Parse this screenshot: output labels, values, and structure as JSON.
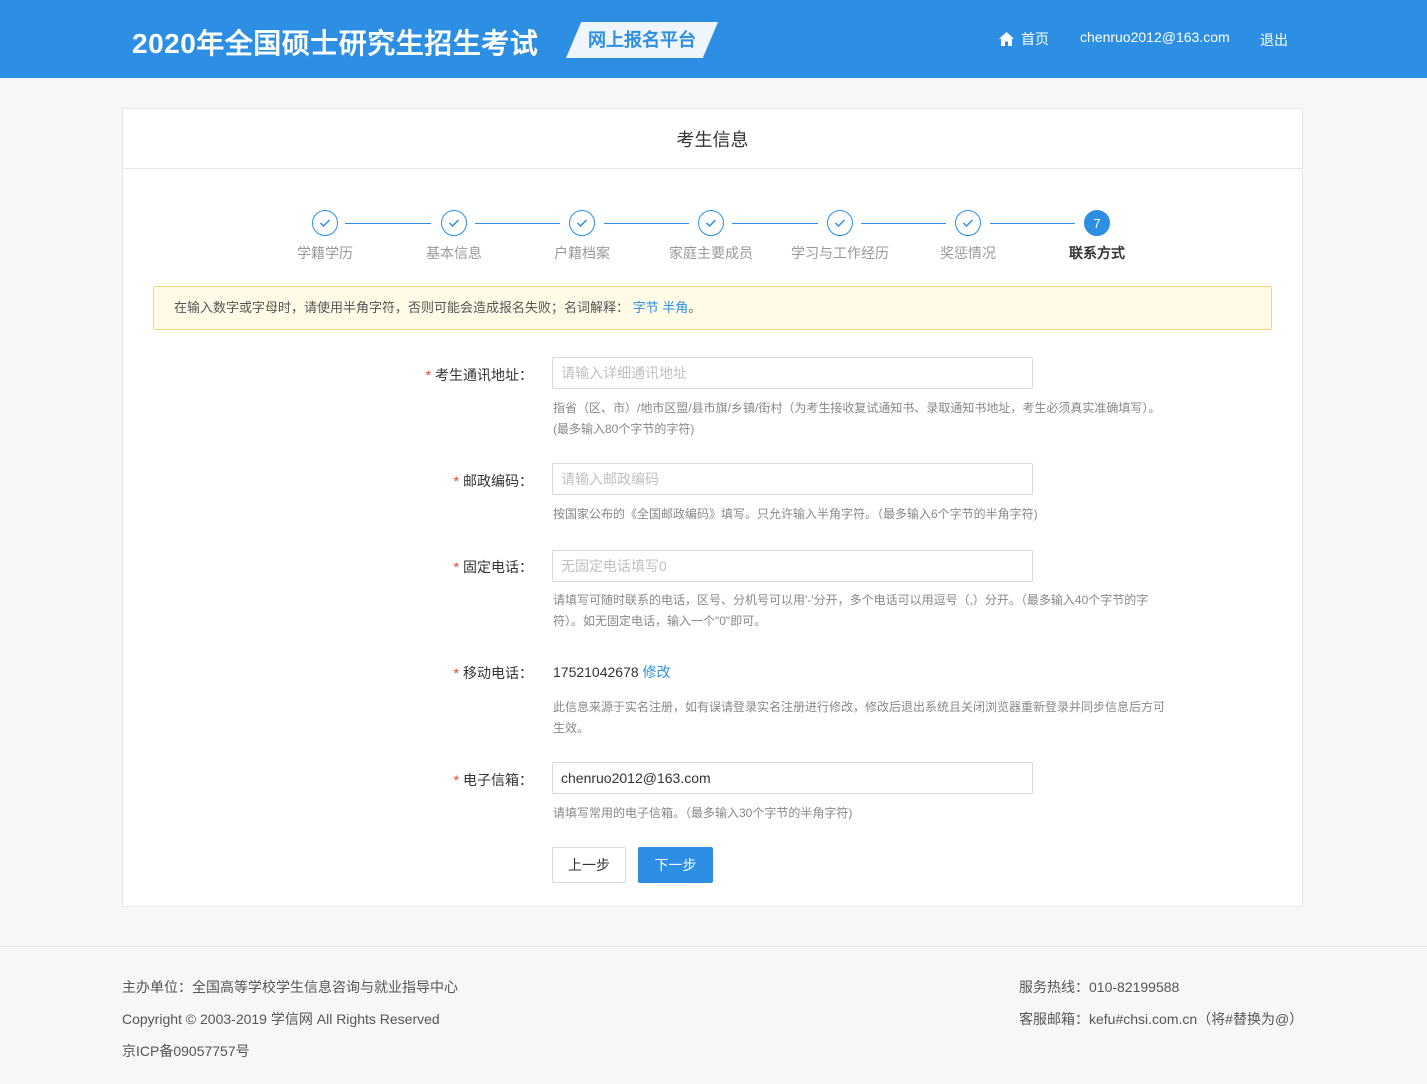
{
  "header": {
    "site_title": "2020年全国硕士研究生招生考试",
    "platform_badge": "网上报名平台",
    "home_label": "首页",
    "user_email": "chenruo2012@163.com",
    "logout_label": "退出"
  },
  "card": {
    "title": "考生信息"
  },
  "steps": [
    {
      "label": "学籍学历",
      "status": "done"
    },
    {
      "label": "基本信息",
      "status": "done"
    },
    {
      "label": "户籍档案",
      "status": "done"
    },
    {
      "label": "家庭主要成员",
      "status": "done"
    },
    {
      "label": "学习与工作经历",
      "status": "done"
    },
    {
      "label": "奖惩情况",
      "status": "done"
    },
    {
      "label": "联系方式",
      "status": "active",
      "number": "7"
    }
  ],
  "notice": {
    "text": "在输入数字或字母时，请使用半角字符，否则可能会造成报名失败；名词解释：",
    "link_byte": "字节",
    "link_halfwidth": "半角",
    "suffix": "。"
  },
  "form": {
    "address": {
      "label": "考生通讯地址：",
      "placeholder": "请输入详细通讯地址",
      "value": "",
      "help": "指省（区、市）/地市区盟/县市旗/乡镇/街村（为考生接收复试通知书、录取通知书地址，考生必须真实准确填写）。(最多输入80个字节的字符)"
    },
    "postcode": {
      "label": "邮政编码：",
      "placeholder": "请输入邮政编码",
      "value": "",
      "help": "按国家公布的《全国邮政编码》填写。只允许输入半角字符。（最多输入6个字节的半角字符)"
    },
    "landline": {
      "label": "固定电话：",
      "placeholder": "无固定电话填写0",
      "value": "",
      "help": "请填写可随时联系的电话，区号、分机号可以用'-'分开，多个电话可以用逗号（,）分开。（最多输入40个字节的字符）。如无固定电话，输入一个\"0\"即可。"
    },
    "mobile": {
      "label": "移动电话：",
      "value": "17521042678",
      "edit_label": "修改",
      "help": "此信息来源于实名注册，如有误请登录实名注册进行修改，修改后退出系统且关闭浏览器重新登录并同步信息后方可生效。"
    },
    "email": {
      "label": "电子信箱：",
      "placeholder": "",
      "value": "chenruo2012@163.com",
      "help": "请填写常用的电子信箱。（最多输入30个字节的半角字符)"
    },
    "required_mark": "*"
  },
  "buttons": {
    "prev": "上一步",
    "next": "下一步"
  },
  "footer": {
    "sponsor": "主办单位：全国高等学校学生信息咨询与就业指导中心",
    "copyright": "Copyright © 2003-2019 学信网 All Rights Reserved",
    "icp": "京ICP备09057757号",
    "hotline": "服务热线：010-82199588",
    "service_email": "客服邮箱：kefu#chsi.com.cn（将#替换为@）"
  },
  "colors": {
    "primary": "#2d8fe3",
    "required": "#f04134",
    "notice_bg": "#fffbe6",
    "notice_border": "#f6d67a"
  }
}
